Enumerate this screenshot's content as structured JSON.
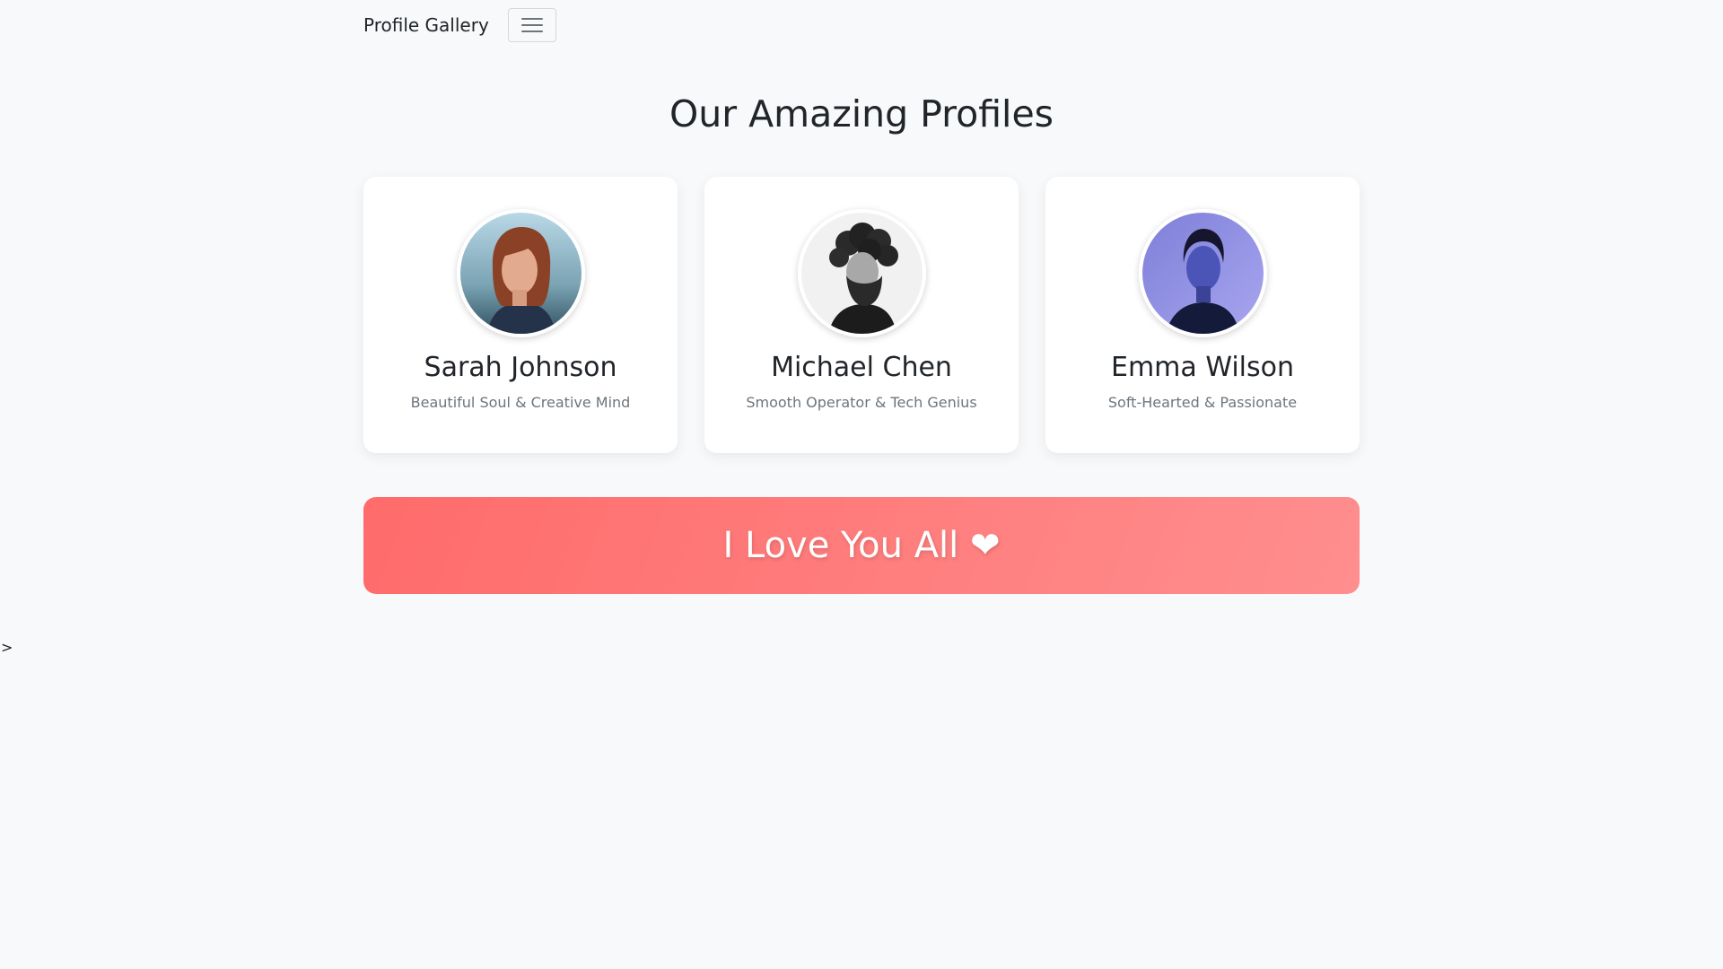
{
  "navbar": {
    "brand": "Profile Gallery",
    "toggler_icon": "hamburger-menu-icon"
  },
  "page_title": "Our Amazing Profiles",
  "profiles": [
    {
      "name": "Sarah Johnson",
      "tagline": "Beautiful Soul & Creative Mind",
      "photo": "woman-red-hair-portrait"
    },
    {
      "name": "Michael Chen",
      "tagline": "Smooth Operator & Tech Genius",
      "photo": "man-curly-hair-beard-bw-portrait"
    },
    {
      "name": "Emma Wilson",
      "tagline": "Soft-Hearted & Passionate",
      "photo": "woman-purple-light-portrait"
    }
  ],
  "banner": {
    "text": "I Love You All ❤",
    "gradient_start": "#ff6b6b",
    "gradient_end": "#ff8e8e"
  },
  "stray_text": ">",
  "colors": {
    "background": "#f8f9fa",
    "card": "#ffffff",
    "text": "#212529",
    "muted": "#6c757d"
  }
}
